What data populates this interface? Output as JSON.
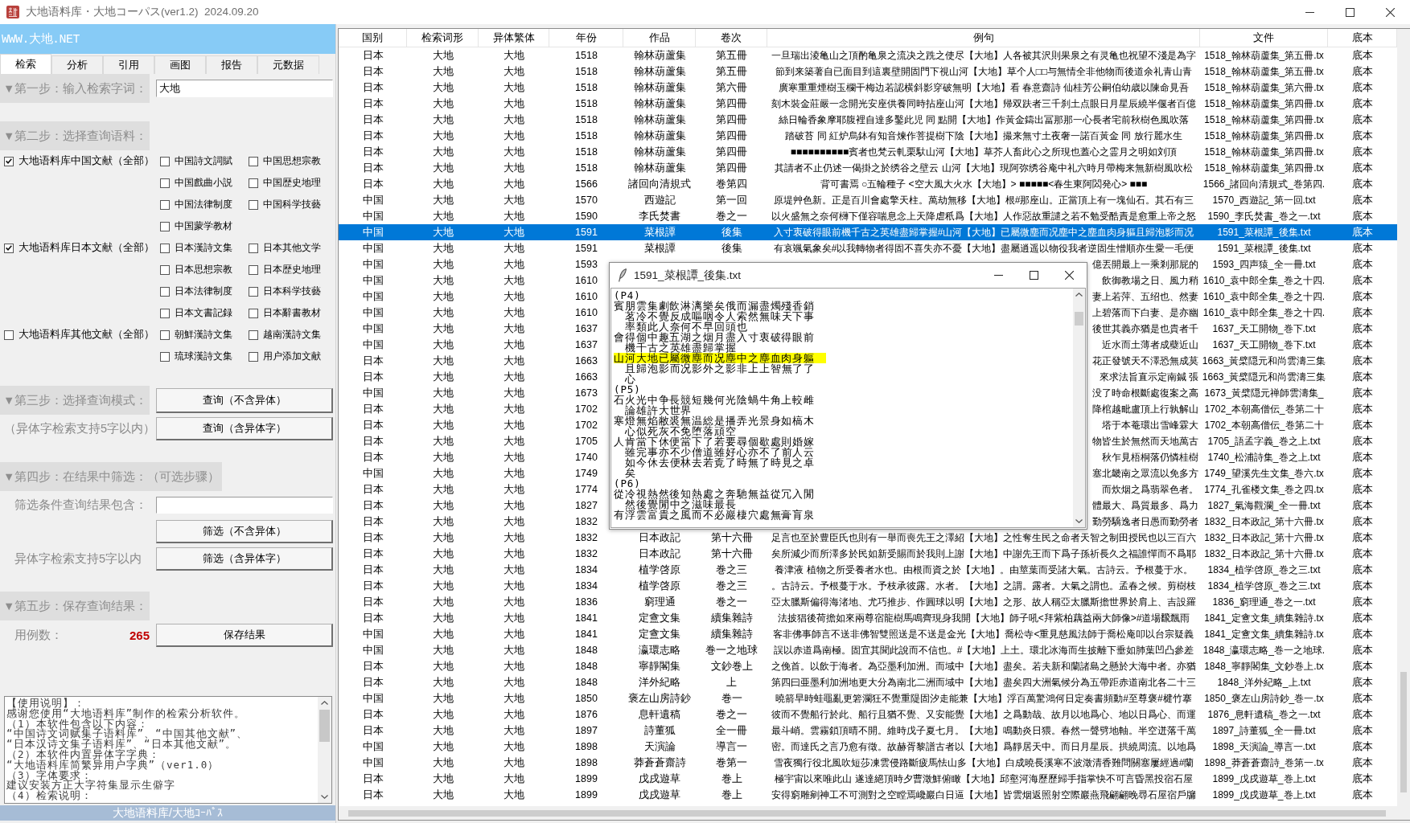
{
  "window": {
    "title": "大地语料库・大地コーパス(ver1.2)  2024.09.20"
  },
  "left_panel": {
    "banner": "WWW.大地.NET",
    "tabs": [
      {
        "label": "检索",
        "selected": true
      },
      {
        "label": "分析",
        "selected": false
      },
      {
        "label": "引用",
        "selected": false
      },
      {
        "label": "画图",
        "selected": false
      },
      {
        "label": "报告",
        "selected": false
      },
      {
        "label": "元数据",
        "selected": false
      }
    ],
    "step1": {
      "heading": "▼第一步：输入检索字词：",
      "search_value": "大地"
    },
    "step2": {
      "heading": "▼第二步：选择查询语料：",
      "groups": [
        {
          "label": "大地语料库中国文献（全部）",
          "checked": true,
          "items": [
            {
              "label": "中国詩文詞賦",
              "checked": false
            },
            {
              "label": "中国思想宗教",
              "checked": false
            },
            {
              "label": "中国戲曲小説",
              "checked": false
            },
            {
              "label": "中国歴史地理",
              "checked": false
            },
            {
              "label": "中国法律制度",
              "checked": false
            },
            {
              "label": "中国科学技藝",
              "checked": false
            },
            {
              "label": "中国蒙学教材",
              "checked": false
            }
          ]
        },
        {
          "label": "大地语料库日本文献（全部）",
          "checked": true,
          "items": [
            {
              "label": "日本漢詩文集",
              "checked": false
            },
            {
              "label": "日本其他文学",
              "checked": false
            },
            {
              "label": "日本思想宗教",
              "checked": false
            },
            {
              "label": "日本歴史地理",
              "checked": false
            },
            {
              "label": "日本法律制度",
              "checked": false
            },
            {
              "label": "日本科学技藝",
              "checked": false
            },
            {
              "label": "日本文書記録",
              "checked": false
            },
            {
              "label": "日本辭書教材",
              "checked": false
            }
          ]
        },
        {
          "label": "大地语料库其他文献（全部）",
          "checked": false,
          "items": [
            {
              "label": "朝鮮漢詩文集",
              "checked": false
            },
            {
              "label": "越南漢詩文集",
              "checked": false
            },
            {
              "label": "琉球漢詩文集",
              "checked": false
            },
            {
              "label": "用户添加文献",
              "checked": false
            }
          ]
        }
      ]
    },
    "step3": {
      "heading": "▼第三步：选择查询模式：",
      "query_button": "查询（不含异体）",
      "note": "（异体字检索支持5字以内）",
      "query_variant_button": "查询（含异体字）"
    },
    "step4": {
      "heading": "▼第四步：在结果中筛选：（可选步骤）",
      "filter_label": "筛选条件查询结果包含：",
      "filter_button": "筛选（不含异体）",
      "note": "异体字检索支持5字以内",
      "filter_variant_button": "筛选（含异体字）"
    },
    "step5": {
      "heading": "▼第五步：保存查询结果：",
      "count_label": "用例数：",
      "count": "265",
      "save_button": "保存结果"
    },
    "help_text": [
      "【使用说明】：",
      "感谢您使用“大地语料库”制作的检索分析软件。",
      "（1）本软件包含以下内容：",
      "“中国诗文词赋集子语料库”、“中国其他文献”、",
      "“日本汉诗文集子语料库”、“日本其他文献”。",
      "（2）本软件内置异体字字典：",
      "“大地语料库简繁异用户字典”（ver1.0）",
      "（3）字体要求：",
      "建议安装方正大字符集显示生僻字",
      "（4）检索说明："
    ],
    "status_bar": "大地语料库/大地ｺｰﾊﾟｽ"
  },
  "results": {
    "columns": [
      "国别",
      "检索词形",
      "异体繁体",
      "年份",
      "作品",
      "卷次",
      "例句",
      "文件",
      "底本"
    ],
    "rows": [
      {
        "country": "日本",
        "term": "大地",
        "variant": "大地",
        "year": "1518",
        "work": "翰林葫蘆集",
        "volume": "第五冊",
        "example": "一旦瑞出淩亀山之頂酌亀泉之流决之跣之使尽【大地】人各被其沢則果泉之有灵亀也祝望不淺是為字",
        "file": "1518_翰林葫蘆集_第五冊.tx",
        "source": "底本",
        "selected": false
      },
      {
        "country": "日本",
        "term": "大地",
        "variant": "大地",
        "year": "1518",
        "work": "翰林葫蘆集",
        "volume": "第五冊",
        "example": "節到来築著自已面目到這裏壁開固門下視山河【大地】草个人□□与無情全非他物而後道余礼青山青",
        "file": "1518_翰林葫蘆集_第五冊.tx",
        "source": "底本",
        "selected": false
      },
      {
        "country": "日本",
        "term": "大地",
        "variant": "大地",
        "year": "1518",
        "work": "翰林葫蘆集",
        "volume": "第六冊",
        "example": "廣寒重重煙樹玉欄干梅边若認横斜影穿破無明【大地】看 春意齋詩 仙桂芳公嗣伯幼歳以陳命見吾",
        "file": "1518_翰林葫蘆集_第六冊.tx",
        "source": "底本",
        "selected": false
      },
      {
        "country": "日本",
        "term": "大地",
        "variant": "大地",
        "year": "1518",
        "work": "翰林葫蘆集",
        "volume": "第四冊",
        "example": "刻木裝金莊嚴一念開光安座供養同時拈座山河【大地】帰双趺者三千刹土点眼日月星辰繞半偃者百億",
        "file": "1518_翰林葫蘆集_第四冊.tx",
        "source": "底本",
        "selected": false
      },
      {
        "country": "日本",
        "term": "大地",
        "variant": "大地",
        "year": "1518",
        "work": "翰林葫蘆集",
        "volume": "第四冊",
        "example": "絲日輪香象摩耶腹裡自達多鑿此児 同 點開【大地】作黃金鑄出冨那那一心長者宅前秋樹色風吹落",
        "file": "1518_翰林葫蘆集_第四冊.tx",
        "source": "底本",
        "selected": false
      },
      {
        "country": "日本",
        "term": "大地",
        "variant": "大地",
        "year": "1518",
        "work": "翰林葫蘆集",
        "volume": "第四冊",
        "example": "踏破苔 同 紅炉烏鉢有知音煉作菩提樹下陰【大地】撮来無寸土夜奢一諾百黃金 同 放行麗水生",
        "file": "1518_翰林葫蘆集_第四冊.tx",
        "source": "底本",
        "selected": false
      },
      {
        "country": "日本",
        "term": "大地",
        "variant": "大地",
        "year": "1518",
        "work": "翰林葫蘆集",
        "volume": "第四冊",
        "example": "■■■■■■■■■■賓者也梵云軋栗馱山河【大地】草芥人畜此心之所現也蓋心之霊月之明如刘頂",
        "file": "1518_翰林葫蘆集_第四冊.tx",
        "source": "底本",
        "selected": false
      },
      {
        "country": "日本",
        "term": "大地",
        "variant": "大地",
        "year": "1518",
        "work": "翰林葫蘆集",
        "volume": "第四冊",
        "example": "其請者不止仍述一偈掛之於绣谷之壁云 山河【大地】現阿弥绣谷庵中礼六時月帶梅来無新樹風吹松",
        "file": "1518_翰林葫蘆集_第四冊.tx",
        "source": "底本",
        "selected": false
      },
      {
        "country": "日本",
        "term": "大地",
        "variant": "大地",
        "year": "1566",
        "work": "諸回向清規式",
        "volume": "巻第四",
        "example": "背可書焉 ○五輪種子 <空大風大火水【大地】> ■■■■■<春生東阿閦発心> ■■■",
        "file": "1566_諸回向清規式_巻第四.",
        "source": "底本",
        "selected": false
      },
      {
        "country": "中国",
        "term": "大地",
        "variant": "大地",
        "year": "1570",
        "work": "西遊記",
        "volume": "第一回",
        "example": "原堤艸色新。正是百川會處擎天柱。萬劫無移【大地】根#那座山。正當頂上有一塊仙石。其石有三",
        "file": "1570_西遊記_第一回.txt",
        "source": "底本",
        "selected": false
      },
      {
        "country": "中国",
        "term": "大地",
        "variant": "大地",
        "year": "1590",
        "work": "李氏焚書",
        "volume": "巻之一",
        "example": "以火盛無之奈何欂下僅容喘息念上天降虐秖爲【大地】人作惡故重譴之若不勉受酷責是愈重上帝之怒",
        "file": "1590_李氏焚書_巻之一.txt",
        "source": "底本",
        "selected": false
      },
      {
        "country": "中国",
        "term": "大地",
        "variant": "大地",
        "year": "1591",
        "work": "菜根譚",
        "volume": "後集",
        "example": "入寸衷破得眼前機千古之英雄盡歸掌握#山河【大地】已屬微塵而况塵中之塵血肉身軀且歸泡影而况",
        "file": "1591_菜根譚_後集.txt",
        "source": "底本",
        "selected": true
      },
      {
        "country": "中国",
        "term": "大地",
        "variant": "大地",
        "year": "1591",
        "work": "菜根譚",
        "volume": "後集",
        "example": "有哀颯氣象矣#以我轉物者得固不喜失亦不憂【大地】盡屬逍遥以物役我者逆固生憎順亦生愛一毛便",
        "file": "1591_菜根譚_後集.txt",
        "source": "底本",
        "selected": false
      },
      {
        "country": "中国",
        "term": "大地",
        "variant": "大地",
        "year": "1593",
        "example": "億丟開最上一乘剎那屁的",
        "file": "1593_四声猿_全一冊.txt",
        "source": "底本",
        "selected": false
      },
      {
        "country": "中国",
        "term": "大地",
        "variant": "大地",
        "year": "1610",
        "example": "飲御教場之日、風力稍",
        "file": "1610_袁中郎全集_巻之十四.",
        "source": "底本",
        "selected": false
      },
      {
        "country": "中国",
        "term": "大地",
        "variant": "大地",
        "year": "1610",
        "example": "妻上若萍、五绍也、然妻",
        "file": "1610_袁中郎全集_巻之十四.",
        "source": "底本",
        "selected": false
      },
      {
        "country": "中国",
        "term": "大地",
        "variant": "大地",
        "year": "1610",
        "example": "上碧落而下白妻、是亦幽",
        "file": "1610_袁中郎全集_巻之十四.",
        "source": "底本",
        "selected": false
      },
      {
        "country": "中国",
        "term": "大地",
        "variant": "大地",
        "year": "1637",
        "example": "後世其義亦猶是也貴者千",
        "file": "1637_天工開物_巻下.txt",
        "source": "底本",
        "selected": false
      },
      {
        "country": "中国",
        "term": "大地",
        "variant": "大地",
        "year": "1637",
        "example": "近水而土薄者成蘗近山",
        "file": "1637_天工開物_巻下.txt",
        "source": "底本",
        "selected": false
      },
      {
        "country": "日本",
        "term": "大地",
        "variant": "大地",
        "year": "1663",
        "example": "花正發號天不澤恐無成莫",
        "file": "1663_黃檗隠元和尚雲濤三集",
        "source": "底本",
        "selected": false
      },
      {
        "country": "日本",
        "term": "大地",
        "variant": "大地",
        "year": "1663",
        "example": "來求法旨直示定南鍼 張",
        "file": "1663_黃檗隠元和尚雲濤三集",
        "source": "底本",
        "selected": false
      },
      {
        "country": "中国",
        "term": "大地",
        "variant": "大地",
        "year": "1673",
        "example": "没了時命根斷處復案之高",
        "file": "1673_黃檗隠元禅師雲濤集_",
        "source": "底本",
        "selected": false
      },
      {
        "country": "日本",
        "term": "大地",
        "variant": "大地",
        "year": "1702",
        "example": "降棺越毗盧頂上行孰解山",
        "file": "1702_本朝高僧伝_巻第二十",
        "source": "底本",
        "selected": false
      },
      {
        "country": "日本",
        "term": "大地",
        "variant": "大地",
        "year": "1702",
        "example": "塔于本菴環出雪峰霖大",
        "file": "1702_本朝高僧伝_巻第二十",
        "source": "底本",
        "selected": false
      },
      {
        "country": "日本",
        "term": "大地",
        "variant": "大地",
        "year": "1705",
        "example": "物皆生於無然而天地萬古",
        "file": "1705_語孟字義_巻之上.txt",
        "source": "底本",
        "selected": false
      },
      {
        "country": "日本",
        "term": "大地",
        "variant": "大地",
        "year": "1740",
        "example": "秋乍見梧桐落仍憐桂樹",
        "file": "1740_松浦詩集_巻之上.txt",
        "source": "底本",
        "selected": false
      },
      {
        "country": "中国",
        "term": "大地",
        "variant": "大地",
        "year": "1749",
        "example": "塞北畿南之眾流以免多方",
        "file": "1749_望溪先生文集_巻六.tx",
        "source": "底本",
        "selected": false
      },
      {
        "country": "日本",
        "term": "大地",
        "variant": "大地",
        "year": "1774",
        "example": "而炊烟之爲翡翠色者。",
        "file": "1774_孔雀楼文集_巻之四.tx",
        "source": "底本",
        "selected": false
      },
      {
        "country": "日本",
        "term": "大地",
        "variant": "大地",
        "year": "1827",
        "example": "體最大、爲質最多、爲力",
        "file": "1827_氣海觀瀾_全一冊.txt",
        "source": "底本",
        "selected": false
      },
      {
        "country": "日本",
        "term": "大地",
        "variant": "大地",
        "year": "1832",
        "example": "勤勞驕逸者日愚而勤勞者",
        "file": "1832_日本政記_第十六冊.tx",
        "source": "底本",
        "selected": false
      },
      {
        "country": "日本",
        "term": "大地",
        "variant": "大地",
        "year": "1832",
        "work": "日本政記",
        "volume": "第十六冊",
        "example": "足言也至於豊臣氏也則有一舉而喪先王之澤紹【大地】之性奪生民之命者天智之制田授民也以三百六",
        "file": "1832_日本政記_第十六冊.tx",
        "source": "底本",
        "selected": false
      },
      {
        "country": "日本",
        "term": "大地",
        "variant": "大地",
        "year": "1832",
        "work": "日本政記",
        "volume": "第十六冊",
        "example": "矣所減少而所澤多於民如新受賜而於我則上謝【大地】中謝先王而下爲子孫祈長久之福誰憚而不爲耶",
        "file": "1832_日本政記_第十六冊.tx",
        "source": "底本",
        "selected": false
      },
      {
        "country": "日本",
        "term": "大地",
        "variant": "大地",
        "year": "1834",
        "work": "植学啓原",
        "volume": "巻之三",
        "example": "養津液 植物之所受養者水也。由根而資之於【大地】。由莖葉而受諸大氣。古詩云。予根蔓于水。",
        "file": "1834_植学啓原_巻之三.txt",
        "source": "底本",
        "selected": false
      },
      {
        "country": "日本",
        "term": "大地",
        "variant": "大地",
        "year": "1834",
        "work": "植学啓原",
        "volume": "巻之三",
        "example": "。古詩云。予根蔓于水。予枝承彼露。水者。【大地】之謂。露者。大氣之謂也。孟春之候。剪樹枝",
        "file": "1834_植学啓原_巻之三.txt",
        "source": "底本",
        "selected": false
      },
      {
        "country": "日本",
        "term": "大地",
        "variant": "大地",
        "year": "1836",
        "work": "窮理通",
        "volume": "巻之一",
        "example": "亞太臘斯偏得海渚地、尤巧推步、作圓球以明【大地】之形、故人稱亞太臘斯擔世界於肩上、吉設羅",
        "file": "1836_窮理通_巻之一.txt",
        "source": "底本",
        "selected": false
      },
      {
        "country": "日本",
        "term": "大地",
        "variant": "大地",
        "year": "1841",
        "work": "定盦文集",
        "volume": "續集雜詩",
        "example": "法披猖後荷擔如來兩尊宿龍樹馬鳴齊現身我開【大地】師子吼<拜紫柏藕益兩大師像>#道場飜飄雨",
        "file": "1841_定盦文集_續集雜詩.tx",
        "source": "底本",
        "selected": false
      },
      {
        "country": "中国",
        "term": "大地",
        "variant": "大地",
        "year": "1841",
        "work": "定盦文集",
        "volume": "續集雜詩",
        "example": "客非佛事師言不送非佛智雙照送是不送是金光【大地】喬松寺<重見慈風法師于喬松庵叩以台宗疑義",
        "file": "1841_定盦文集_續集雜詩.tx",
        "source": "底本",
        "selected": false
      },
      {
        "country": "中国",
        "term": "大地",
        "variant": "大地",
        "year": "1848",
        "work": "瀛環志略",
        "volume": "巻一之地球",
        "example": "誤以赤道爲南極。固宜其聞此說而不信也。#【大地】上土。環北冰海而生披離下垂如肺葉凹凸參差",
        "file": "1848_瀛環志略_巻一之地球.",
        "source": "底本",
        "selected": false
      },
      {
        "country": "日本",
        "term": "大地",
        "variant": "大地",
        "year": "1848",
        "work": "寧靜閣集",
        "volume": "文鈔巻上",
        "example": "之俛首。以飲于海者。為亞墨利加洲。而域中【大地】盡矣。若夫新和蘭諸島之懸於大海中者。亦猶",
        "file": "1848_寧靜閣集_文鈔巻上.tx",
        "source": "底本",
        "selected": false
      },
      {
        "country": "日本",
        "term": "大地",
        "variant": "大地",
        "year": "1848",
        "work": "洋外紀略",
        "volume": "上",
        "example": "第四曰亜墨利加洲地更大分為南北二洲而域中【大地】盡矣四大洲氣候分為五帶距赤道南北各二十三",
        "file": "1848_洋外紀略_上.txt",
        "source": "底本",
        "selected": false
      },
      {
        "country": "中国",
        "term": "大地",
        "variant": "大地",
        "year": "1850",
        "work": "褒左山房詩鈔",
        "volume": "巻一",
        "example": "曉箭早時蛙黽亂更箬瀾狂不覺重隄固汐走能兼【大地】浮百萬驚鴻何日定奏書頻動#至尊褒#楗竹搴",
        "file": "1850_褒左山房詩鈔_巻一.tx",
        "source": "底本",
        "selected": false
      },
      {
        "country": "日本",
        "term": "大地",
        "variant": "大地",
        "year": "1876",
        "work": "息軒遺稿",
        "volume": "巻之一",
        "example": "彼而不覺船行於此、船行且猶不覺、又安能覺【大地】之爲動哉、故月以地爲心、地以日爲心、而運",
        "file": "1876_息軒遺稿_巻之一.txt",
        "source": "底本",
        "selected": false
      },
      {
        "country": "日本",
        "term": "大地",
        "variant": "大地",
        "year": "1897",
        "work": "詩董狐",
        "volume": "全一冊",
        "example": "最斗峭。雲霧鎖頂晴不開。維時戊子夏七月。【大地】鳴動炎日猥。春然一聲劈地軸。半空迸落千萬",
        "file": "1897_詩董狐_全一冊.txt",
        "source": "底本",
        "selected": false
      },
      {
        "country": "中国",
        "term": "大地",
        "variant": "大地",
        "year": "1898",
        "work": "天演論",
        "volume": "導言一",
        "example": "密。而達氏之言乃愈有徵。故赫胥黎譜古者以【大地】爲靜居天中。而日月星辰。拱繞周流。以地爲",
        "file": "1898_天演論_導言一.txt",
        "source": "底本",
        "selected": false
      },
      {
        "country": "中国",
        "term": "大地",
        "variant": "大地",
        "year": "1898",
        "work": "莽蒼蒼齋詩",
        "volume": "巻第一",
        "example": "雪夜獨行役北風吹短莎凍雲侵路斷疲馬怯山多【大地】白成曉長溪寒不波澂清香難問關塞屢經過#蘭",
        "file": "1898_莽蒼蒼齋詩_巻第一.tx",
        "source": "底本",
        "selected": false
      },
      {
        "country": "日本",
        "term": "大地",
        "variant": "大地",
        "year": "1899",
        "work": "戊戌遊草",
        "volume": "巻上",
        "example": "極宇宙以來唯此山 遂達絕頂時夕曹澂鮮俯瞰【大地】邱壑河海歷歷歸手指掌快不可言昏黑投宿石屋",
        "file": "1899_戊戌遊草_巻上.txt",
        "source": "底本",
        "selected": false
      },
      {
        "country": "日本",
        "term": "大地",
        "variant": "大地",
        "year": "1899",
        "work": "戊戌遊草",
        "volume": "巻上",
        "example": "安得窮雕剜神工不可測對之空瞠焉巉巖白日逼【大地】皆雲烟返照射空際巖燕飛翩翩晚尋石屋宿戶牖",
        "file": "1899_戊戌遊草_巻上.txt",
        "source": "底本",
        "selected": false
      }
    ]
  },
  "popup": {
    "title": "1591_菜根譚_後集.txt",
    "lines": [
      {
        "kind": "line",
        "text": "(P4)",
        "highlighted": false
      },
      {
        "kind": "line",
        "text": "賓朋雲集劇飲淋漓樂矣俄而漏盡燭殘香銷",
        "highlighted": false
      },
      {
        "kind": "continuation",
        "text": "茗冷不覺反成嘔咽令人索然無味天下事",
        "highlighted": false
      },
      {
        "kind": "continuation",
        "text": "率類此人奈何不早回頭也",
        "highlighted": false
      },
      {
        "kind": "line",
        "text": "會得個中趣五湖之烟月盡入寸衷破得眼前",
        "highlighted": false
      },
      {
        "kind": "continuation",
        "text": "機千古之英雄盡歸掌握",
        "highlighted": false
      },
      {
        "kind": "line",
        "text": "山河大地已屬微塵而况塵中之塵血肉身軀",
        "highlighted": true
      },
      {
        "kind": "continuation",
        "text": "且歸泡影而况影外之影非上上智無了了",
        "highlighted": false
      },
      {
        "kind": "continuation",
        "text": "心",
        "highlighted": false
      },
      {
        "kind": "line",
        "text": "(P5)",
        "highlighted": false
      },
      {
        "kind": "line",
        "text": "石火光中争長競短幾何光陰蝸牛角上較雌",
        "highlighted": false
      },
      {
        "kind": "continuation",
        "text": "論雄許大世界",
        "highlighted": false
      },
      {
        "kind": "line",
        "text": "寒燈無焰敝裘無温総是播弄光景身如槁木",
        "highlighted": false
      },
      {
        "kind": "continuation",
        "text": "心似死灰不免堕落頑空",
        "highlighted": false
      },
      {
        "kind": "line",
        "text": "人肯當下休便當下了若要尋個歇處則婚嫁",
        "highlighted": false
      },
      {
        "kind": "continuation",
        "text": "雖完事亦不少僧道雖好心亦不了前人云",
        "highlighted": false
      },
      {
        "kind": "continuation",
        "text": "如今休去便林去若覔了時無了時見之卓",
        "highlighted": false
      },
      {
        "kind": "continuation",
        "text": "矣",
        "highlighted": false
      },
      {
        "kind": "line",
        "text": "(P6)",
        "highlighted": false
      },
      {
        "kind": "line",
        "text": "從冷視熱然後知熱處之奔馳無益從冗入閒",
        "highlighted": false
      },
      {
        "kind": "continuation",
        "text": "然後覺閒中之滋味最長",
        "highlighted": false
      },
      {
        "kind": "line",
        "text": "有浮雲富貴之風而不必巖棲穴處無膏肓泉",
        "highlighted": false
      }
    ]
  }
}
